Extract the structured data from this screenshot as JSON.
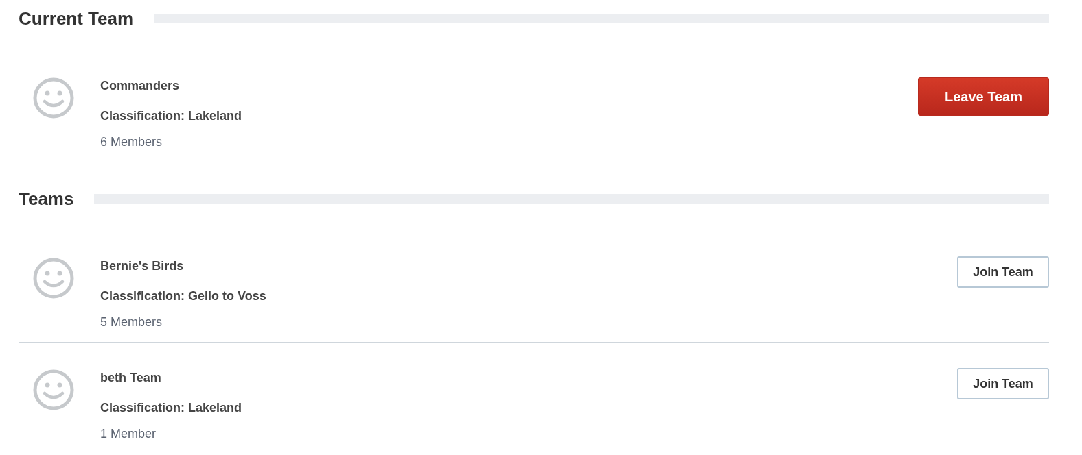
{
  "sections": [
    {
      "title": "Current Team",
      "teams": [
        {
          "name": "Commanders",
          "classification": "Classification: Lakeland",
          "members": "6 Members",
          "button": {
            "label": "Leave Team",
            "kind": "leave"
          }
        }
      ]
    },
    {
      "title": "Teams",
      "teams": [
        {
          "name": "Bernie's Birds",
          "classification": "Classification: Geilo to Voss",
          "members": "5 Members",
          "button": {
            "label": "Join Team",
            "kind": "join"
          }
        },
        {
          "name": "beth Team",
          "classification": "Classification: Lakeland",
          "members": "1 Member",
          "button": {
            "label": "Join Team",
            "kind": "join"
          }
        }
      ]
    }
  ]
}
